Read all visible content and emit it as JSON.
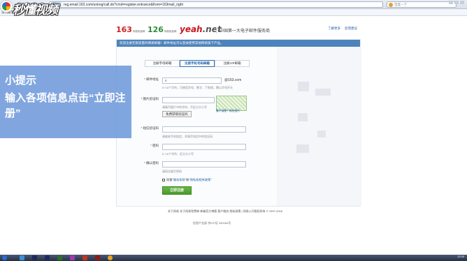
{
  "browser": {
    "address_tag": "网址",
    "url": "reg.email.163.com/unireg/call.do?cmd=register.entrance&from=163mail_right",
    "search_placeholder": "百度一下",
    "bookmark": "访问最常访问"
  },
  "watermark": {
    "text": "秒懂视频"
  },
  "header": {
    "logo_163": "163",
    "logo_163_sub": "网易免费邮",
    "logo_126": "126",
    "logo_126_sub": "网易免费邮",
    "logo_yeah": "yeah",
    "logo_yeah_suffix": ".net",
    "slogan": "中国第一大电子邮件服务商",
    "links": [
      "了解更多",
      "反馈建议"
    ]
  },
  "notice": "欢迎注册无限容量的网易邮箱！邮件地址可以登录使用其他网易旗下产品。",
  "tabs": [
    {
      "label": "注册字母邮箱",
      "active": false
    },
    {
      "label": "注册手机号码邮箱",
      "active": true
    },
    {
      "label": "注册VIP邮箱",
      "active": false
    }
  ],
  "form": {
    "email_label": "邮件地址",
    "email_value": "8",
    "email_suffix": "@163.com",
    "email_hint": "6~18个字符，可使用字母、数字、下划线，需以字母开头",
    "captcha_label": "图片验证码",
    "captcha_hint": "请填写图片中的字符，不区分大小写",
    "captcha_link": "看不清楚？换张图片",
    "sms_button": "免费获取验证码",
    "sms_label": "短信验证码",
    "sms_hint": "请查收手机短信，并填写短信中的验证码",
    "password_label": "密码",
    "password_hint": "6~16个字符，区分大小写",
    "confirm_label": "确认密码",
    "confirm_hint": "请再次填写密码",
    "agree_text": "同意",
    "agree_link1": "\"服务条款\"",
    "agree_and": "和",
    "agree_link2": "\"隐私权相关政策\"",
    "submit": "立即注册"
  },
  "footer": {
    "links": "关于网易  关于网易免费邮  邮箱官方博客  客户服务  隐私政策  |  网易公司版权所有 © 1997-2016",
    "copy": "信息产业部 京ICP证 030184号"
  },
  "callout": {
    "title": "小提示",
    "body": "输入各项信息点击“立即注册”"
  },
  "taskbar": {
    "time": "12:00",
    "date": "2016/1/1"
  }
}
